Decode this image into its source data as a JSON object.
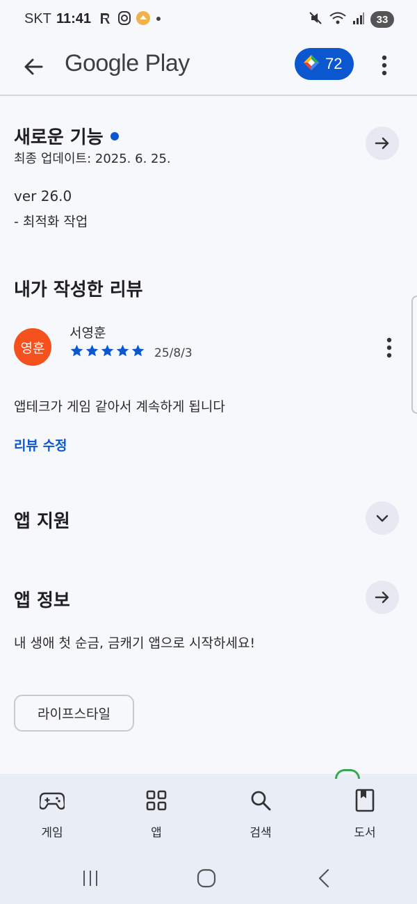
{
  "status_bar": {
    "carrier": "SKT",
    "time": "11:41",
    "battery": "33"
  },
  "app_bar": {
    "title": "Google Play",
    "points": "72"
  },
  "whats_new": {
    "title": "새로운 기능",
    "updated": "최종 업데이트: 2025. 6. 25.",
    "version": "ver 26.0",
    "note": "- 최적화 작업"
  },
  "my_review": {
    "title": "내가 작성한 리뷰",
    "avatar_text": "영훈",
    "reviewer": "서영훈",
    "rating": 5,
    "date": "25/8/3",
    "text": "앱테크가 게임 같아서 계속하게 됩니다",
    "edit_label": "리뷰 수정"
  },
  "app_support": {
    "title": "앱 지원"
  },
  "app_info": {
    "title": "앱 정보",
    "description": "내 생애 첫 순금, 금캐기 앱으로 시작하세요!",
    "category_chip": "라이프스타일"
  },
  "bottom_nav": {
    "items": [
      {
        "label": "게임",
        "icon": "gamepad-icon"
      },
      {
        "label": "앱",
        "icon": "apps-grid-icon"
      },
      {
        "label": "검색",
        "icon": "search-icon"
      },
      {
        "label": "도서",
        "icon": "book-icon"
      }
    ]
  },
  "colors": {
    "accent": "#0b57d0",
    "avatar": "#f4511e",
    "star": "#0b57d0",
    "background": "#f7f8fc",
    "nav_background": "#e9edf5"
  }
}
